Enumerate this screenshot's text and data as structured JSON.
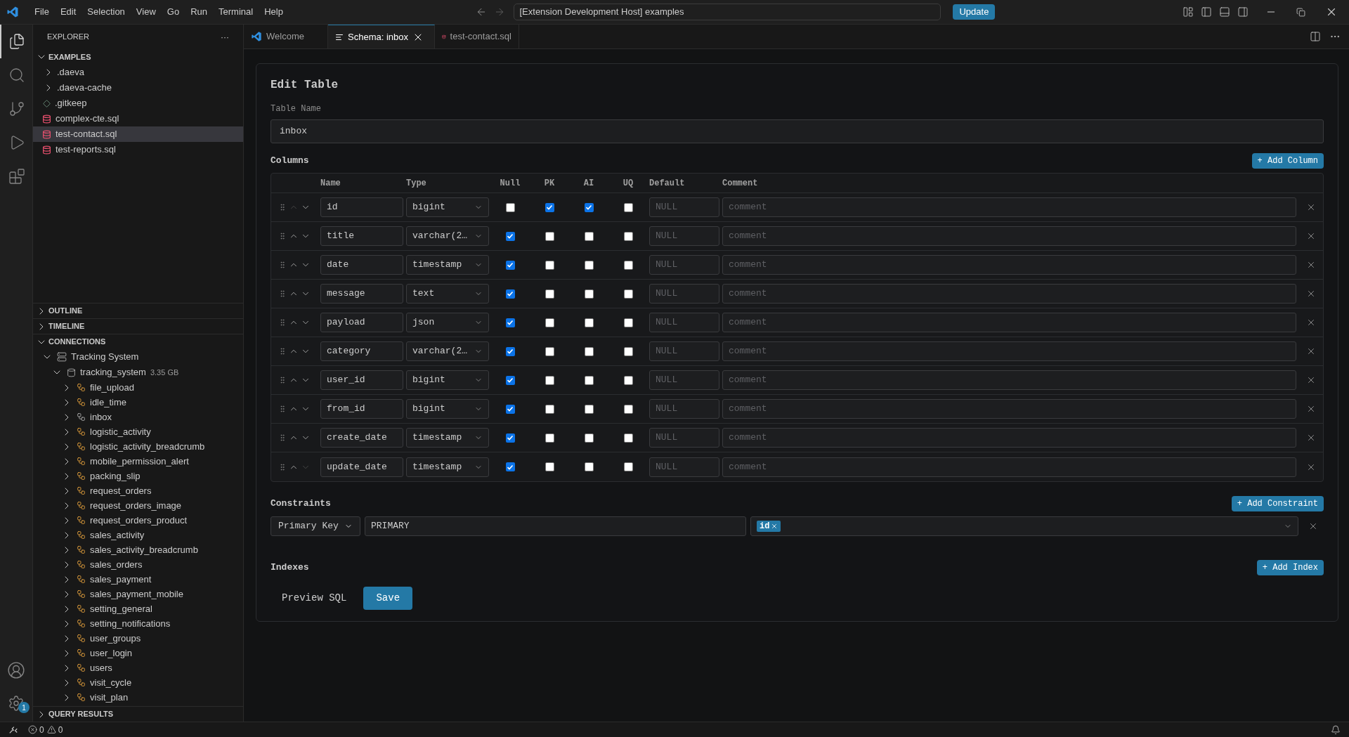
{
  "menu": [
    "File",
    "Edit",
    "Selection",
    "View",
    "Go",
    "Run",
    "Terminal",
    "Help"
  ],
  "command_center": "[Extension Development Host] examples",
  "update_button": "Update",
  "activity_bar": [
    {
      "kind": "files",
      "selected": true
    },
    {
      "kind": "search",
      "selected": false
    },
    {
      "kind": "source-control",
      "selected": false
    },
    {
      "kind": "run",
      "selected": false
    },
    {
      "kind": "extensions",
      "selected": false
    }
  ],
  "settings_badge": "1",
  "explorer": {
    "title": "EXPLORER",
    "more": "···",
    "folder": "EXAMPLES",
    "expanded": true,
    "items": [
      {
        "label": ".daeva",
        "kind": "folder",
        "selected": false
      },
      {
        "label": ".daeva-cache",
        "kind": "folder",
        "selected": false
      },
      {
        "label": ".gitkeep",
        "kind": "file",
        "selected": false
      },
      {
        "label": "complex-cte.sql",
        "kind": "sql",
        "selected": false
      },
      {
        "label": "test-contact.sql",
        "kind": "sql",
        "selected": true
      },
      {
        "label": "test-reports.sql",
        "kind": "sql",
        "selected": false
      }
    ]
  },
  "panels": [
    {
      "label": "OUTLINE",
      "expanded": false
    },
    {
      "label": "TIMELINE",
      "expanded": false
    }
  ],
  "connections": {
    "label": "CONNECTIONS",
    "expanded": true,
    "server": {
      "label": "Tracking System",
      "expanded": true
    },
    "database": {
      "label": "tracking_system",
      "size": "3.35 GB",
      "expanded": true
    },
    "tables": [
      {
        "label": "file_upload",
        "open": false
      },
      {
        "label": "idle_time",
        "open": false
      },
      {
        "label": "inbox",
        "open": true
      },
      {
        "label": "logistic_activity",
        "open": false
      },
      {
        "label": "logistic_activity_breadcrumb",
        "open": false
      },
      {
        "label": "mobile_permission_alert",
        "open": false
      },
      {
        "label": "packing_slip",
        "open": false
      },
      {
        "label": "request_orders",
        "open": false
      },
      {
        "label": "request_orders_image",
        "open": false
      },
      {
        "label": "request_orders_product",
        "open": false
      },
      {
        "label": "sales_activity",
        "open": false
      },
      {
        "label": "sales_activity_breadcrumb",
        "open": false
      },
      {
        "label": "sales_orders",
        "open": false
      },
      {
        "label": "sales_payment",
        "open": false
      },
      {
        "label": "sales_payment_mobile",
        "open": false
      },
      {
        "label": "setting_general",
        "open": false
      },
      {
        "label": "setting_notifications",
        "open": false
      },
      {
        "label": "user_groups",
        "open": false
      },
      {
        "label": "user_login",
        "open": false
      },
      {
        "label": "users",
        "open": false
      },
      {
        "label": "visit_cycle",
        "open": false
      },
      {
        "label": "visit_plan",
        "open": false
      }
    ]
  },
  "query_results": {
    "label": "QUERY RESULTS",
    "expanded": false
  },
  "tabs": [
    {
      "label": "Welcome",
      "kind": "welcome",
      "selected": false
    },
    {
      "label": "Schema: inbox",
      "kind": "schema",
      "selected": true
    },
    {
      "label": "test-contact.sql",
      "kind": "sql",
      "selected": false
    }
  ],
  "editor": {
    "title": "Edit Table",
    "table_name_label": "Table Name",
    "table_name": "inbox",
    "columns_heading": "Columns",
    "add_column": "+ Add Column",
    "headers": [
      "Name",
      "Type",
      "Null",
      "PK",
      "AI",
      "UQ",
      "Default",
      "Comment"
    ],
    "columns": [
      {
        "name": "id",
        "type": "bigint",
        "null": false,
        "pk": true,
        "ai": true,
        "uq": false,
        "default_placeholder": "NULL",
        "comment_placeholder": "comment",
        "can_move_up": false,
        "can_move_down": true
      },
      {
        "name": "title",
        "type": "varchar(2…",
        "null": true,
        "pk": false,
        "ai": false,
        "uq": false,
        "default_placeholder": "NULL",
        "comment_placeholder": "comment",
        "can_move_up": true,
        "can_move_down": true
      },
      {
        "name": "date",
        "type": "timestamp",
        "null": true,
        "pk": false,
        "ai": false,
        "uq": false,
        "default_placeholder": "NULL",
        "comment_placeholder": "comment",
        "can_move_up": true,
        "can_move_down": true
      },
      {
        "name": "message",
        "type": "text",
        "null": true,
        "pk": false,
        "ai": false,
        "uq": false,
        "default_placeholder": "NULL",
        "comment_placeholder": "comment",
        "can_move_up": true,
        "can_move_down": true
      },
      {
        "name": "payload",
        "type": "json",
        "null": true,
        "pk": false,
        "ai": false,
        "uq": false,
        "default_placeholder": "NULL",
        "comment_placeholder": "comment",
        "can_move_up": true,
        "can_move_down": true
      },
      {
        "name": "category",
        "type": "varchar(2…",
        "null": true,
        "pk": false,
        "ai": false,
        "uq": false,
        "default_placeholder": "NULL",
        "comment_placeholder": "comment",
        "can_move_up": true,
        "can_move_down": true
      },
      {
        "name": "user_id",
        "type": "bigint",
        "null": true,
        "pk": false,
        "ai": false,
        "uq": false,
        "default_placeholder": "NULL",
        "comment_placeholder": "comment",
        "can_move_up": true,
        "can_move_down": true
      },
      {
        "name": "from_id",
        "type": "bigint",
        "null": true,
        "pk": false,
        "ai": false,
        "uq": false,
        "default_placeholder": "NULL",
        "comment_placeholder": "comment",
        "can_move_up": true,
        "can_move_down": true
      },
      {
        "name": "create_date",
        "type": "timestamp",
        "null": true,
        "pk": false,
        "ai": false,
        "uq": false,
        "default_placeholder": "NULL",
        "comment_placeholder": "comment",
        "can_move_up": true,
        "can_move_down": true
      },
      {
        "name": "update_date",
        "type": "timestamp",
        "null": true,
        "pk": false,
        "ai": false,
        "uq": false,
        "default_placeholder": "NULL",
        "comment_placeholder": "comment",
        "can_move_up": true,
        "can_move_down": false
      }
    ],
    "constraints_heading": "Constraints",
    "add_constraint": "+ Add Constraint",
    "constraints": [
      {
        "type": "Primary Key",
        "name": "PRIMARY",
        "columns": [
          "id"
        ]
      }
    ],
    "indexes_heading": "Indexes",
    "add_index": "+ Add Index",
    "preview_sql": "Preview SQL",
    "save": "Save"
  },
  "status": {
    "errors": "0",
    "warnings": "0"
  }
}
